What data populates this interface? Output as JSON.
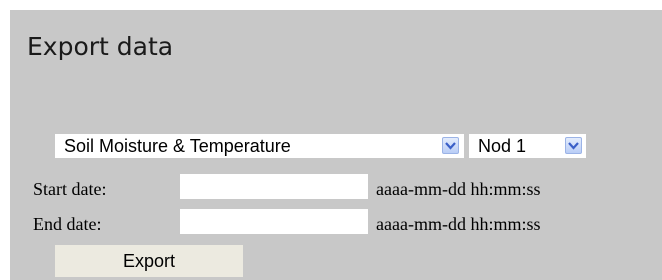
{
  "title": "Export data",
  "sensor_select": {
    "value": "Soil Moisture & Temperature"
  },
  "node_select": {
    "value": "Nod 1"
  },
  "start_date": {
    "label": "Start date:",
    "value": "",
    "hint": "aaaa-mm-dd hh:mm:ss"
  },
  "end_date": {
    "label": "End date:",
    "value": "",
    "hint": "aaaa-mm-dd hh:mm:ss"
  },
  "export_button": {
    "label": "Export"
  },
  "colors": {
    "panel": "#c8c8c8",
    "button": "#eceae0",
    "dropdown_arrow": "#3a5fc8"
  },
  "icons": {
    "dropdown": "chevron-down-icon"
  }
}
